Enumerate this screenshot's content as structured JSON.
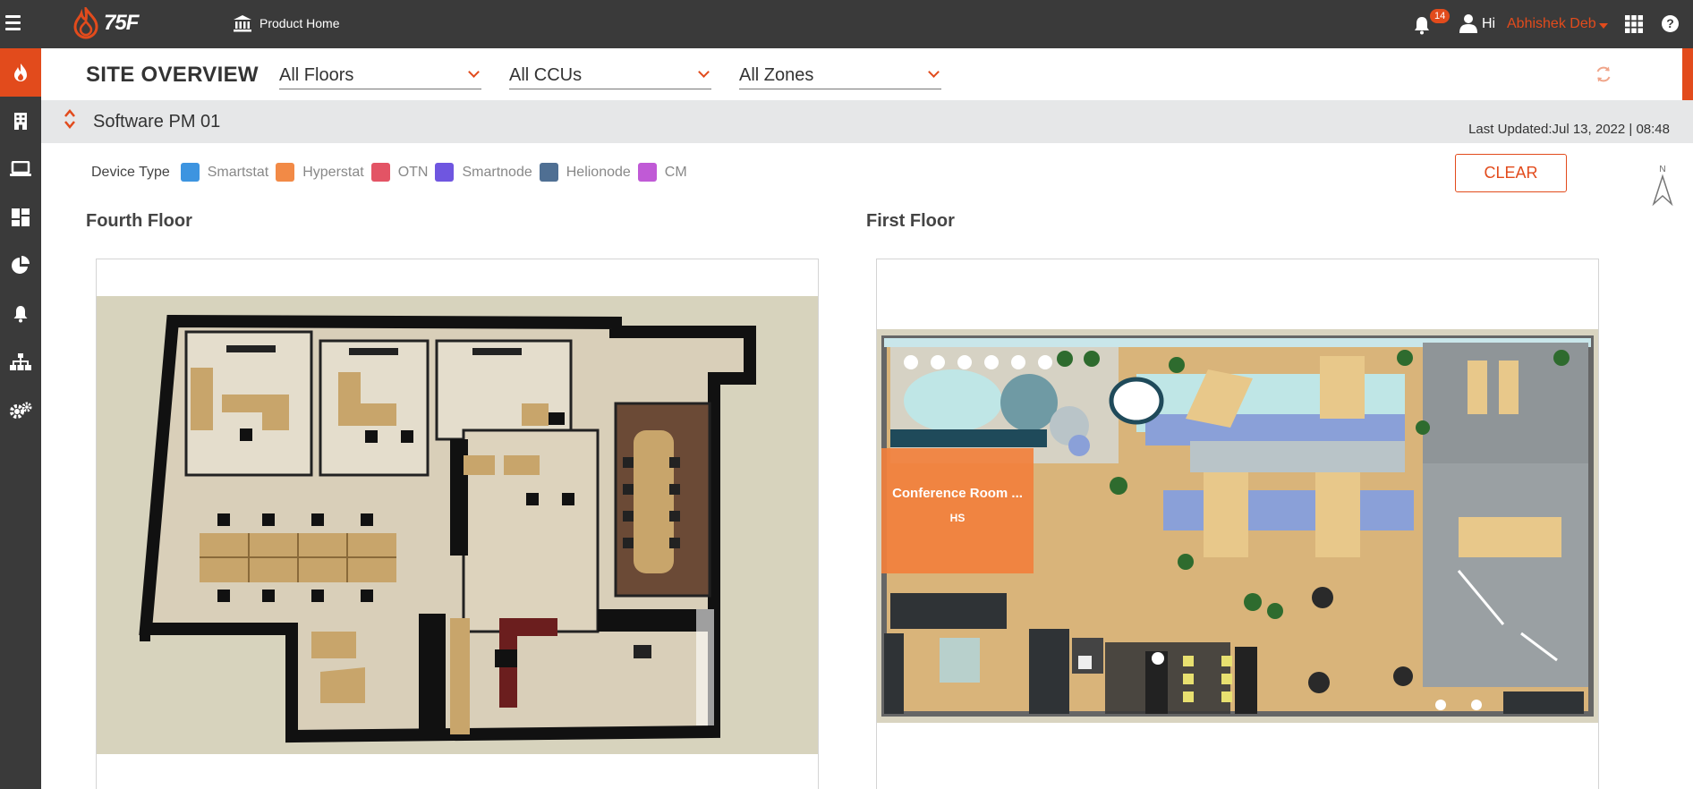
{
  "topbar": {
    "logo_text": "75F",
    "product_home_label": "Product Home",
    "notification_count": "14",
    "greeting": "Hi",
    "user_name": "Abhishek Deb",
    "help_label": "?"
  },
  "sidebar": {
    "items": [
      {
        "icon": "flame-icon",
        "active": true
      },
      {
        "icon": "building-icon"
      },
      {
        "icon": "laptop-icon"
      },
      {
        "icon": "dashboard-icon"
      },
      {
        "icon": "pie-chart-icon"
      },
      {
        "icon": "bell-icon"
      },
      {
        "icon": "hierarchy-icon"
      },
      {
        "icon": "settings-icon"
      }
    ]
  },
  "header": {
    "title": "SITE OVERVIEW",
    "floors_filter": "All Floors",
    "ccus_filter": "All CCUs",
    "zones_filter": "All Zones"
  },
  "site": {
    "name": "Software PM 01",
    "last_updated": "Last Updated:Jul 13, 2022 | 08:48"
  },
  "legend": {
    "label": "Device Type",
    "items": [
      {
        "name": "Smartstat",
        "color": "#3d94e0"
      },
      {
        "name": "Hyperstat",
        "color": "#f28a46"
      },
      {
        "name": "OTN",
        "color": "#e35465"
      },
      {
        "name": "Smartnode",
        "color": "#6f56e0"
      },
      {
        "name": "Helionode",
        "color": "#4f6f93"
      },
      {
        "name": "CM",
        "color": "#c05ad6"
      }
    ],
    "clear_label": "CLEAR",
    "north_label": "N"
  },
  "floors": [
    {
      "name": "Fourth Floor"
    },
    {
      "name": "First Floor",
      "zone": {
        "name": "Conference Room ...",
        "device": "HS"
      }
    }
  ],
  "colors": {
    "accent": "#e24b1c",
    "topbar": "#3a3a3a"
  }
}
